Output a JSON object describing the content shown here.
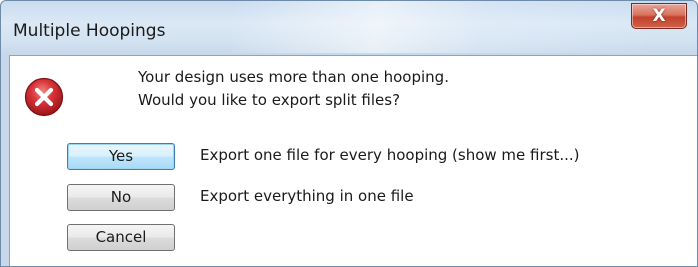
{
  "dialog": {
    "title": "Multiple Hoopings",
    "close_glyph": "X",
    "icon": "error-icon",
    "message_lines": [
      "Your design uses more than one hooping.",
      "Would you like to export split files?"
    ],
    "options": [
      {
        "label": "Yes",
        "description": "Export one file for every hooping  (show me first...)",
        "default": true
      },
      {
        "label": "No",
        "description": "Export everything in one file",
        "default": false
      },
      {
        "label": "Cancel",
        "description": "",
        "default": false
      }
    ]
  },
  "colors": {
    "error_red": "#c8242a",
    "default_button_border": "#3c7fb1",
    "close_button": "#c2422c"
  }
}
